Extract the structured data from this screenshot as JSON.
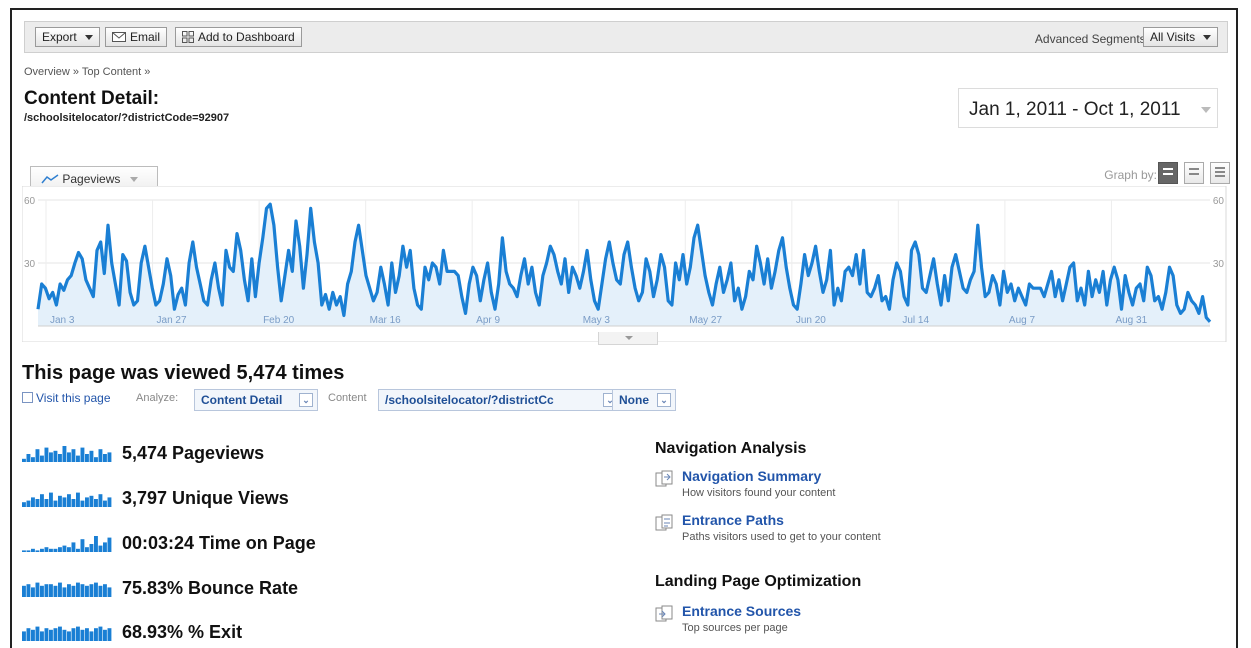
{
  "toolbar": {
    "export_label": "Export",
    "email_label": "Email",
    "dashboard_label": "Add to Dashboard",
    "segments_label": "Advanced Segments:",
    "segments_value": "All Visits"
  },
  "breadcrumb": "Overview » Top Content »",
  "page": {
    "title": "Content Detail:",
    "subtitle": "/schoolsitelocator/?districtCode=92907",
    "date_range": "Jan 1, 2011 - Oct 1, 2011"
  },
  "graph": {
    "tab_label": "Pageviews",
    "graph_by_label": "Graph by:",
    "accent": "#1a7fd4",
    "fill": "#e4f0fa"
  },
  "chart_data": {
    "type": "area",
    "ylim": [
      0,
      60
    ],
    "yticks": [
      "60",
      "30"
    ],
    "x_tick_labels": [
      "Jan 3",
      "Jan 27",
      "Feb 20",
      "Mar 16",
      "Apr 9",
      "May 3",
      "May 27",
      "Jun 20",
      "Jul 14",
      "Aug 7",
      "Aug 31"
    ],
    "series": [
      {
        "values": [
          8,
          20,
          18,
          13,
          16,
          10,
          20,
          17,
          22,
          24,
          30,
          35,
          32,
          22,
          18,
          14,
          36,
          40,
          25,
          48,
          30,
          20,
          10,
          34,
          31,
          16,
          10,
          12,
          30,
          38,
          28,
          18,
          10,
          12,
          20,
          32,
          24,
          8,
          15,
          18,
          10,
          30,
          40,
          28,
          20,
          12,
          10,
          22,
          30,
          18,
          10,
          36,
          28,
          26,
          44,
          36,
          22,
          12,
          32,
          14,
          30,
          42,
          56,
          58,
          48,
          28,
          12,
          24,
          36,
          26,
          50,
          38,
          18,
          34,
          56,
          40,
          30,
          10,
          15,
          8,
          16,
          10,
          14,
          5,
          20,
          26,
          40,
          48,
          36,
          24,
          18,
          12,
          16,
          28,
          20,
          10,
          30,
          16,
          24,
          38,
          28,
          36,
          18,
          10,
          8,
          28,
          22,
          30,
          28,
          20,
          36,
          26,
          26,
          26,
          24,
          14,
          6,
          20,
          28,
          24,
          12,
          22,
          30,
          16,
          8,
          20,
          42,
          26,
          20,
          18,
          14,
          24,
          32,
          20,
          28,
          16,
          10,
          24,
          30,
          38,
          34,
          26,
          20,
          32,
          16,
          28,
          24,
          18,
          26,
          36,
          22,
          12,
          8,
          20,
          32,
          40,
          30,
          22,
          20,
          34,
          40,
          28,
          18,
          12,
          16,
          32,
          26,
          14,
          22,
          34,
          28,
          12,
          10,
          30,
          22,
          34,
          20,
          28,
          42,
          48,
          36,
          24,
          16,
          10,
          20,
          28,
          16,
          22,
          30,
          12,
          18,
          8,
          14,
          26,
          22,
          38,
          30,
          20,
          32,
          18,
          26,
          36,
          42,
          28,
          18,
          10,
          8,
          20,
          34,
          24,
          30,
          38,
          26,
          16,
          22,
          36,
          10,
          18,
          12,
          26,
          28,
          24,
          34,
          20,
          36,
          16,
          14,
          18,
          24,
          12,
          14,
          8,
          22,
          30,
          26,
          14,
          10,
          36,
          40,
          34,
          18,
          16,
          24,
          32,
          20,
          10,
          24,
          12,
          28,
          34,
          26,
          18,
          16,
          22,
          26,
          48,
          28,
          14,
          16,
          24,
          20,
          10,
          26,
          16,
          20,
          12,
          18,
          14,
          10,
          20,
          18,
          18,
          18,
          14,
          20,
          26,
          14,
          22,
          12,
          20,
          28,
          30,
          12,
          18,
          10,
          26,
          14,
          22,
          16,
          26,
          10,
          22,
          28,
          22,
          8,
          24,
          16,
          10,
          18,
          20,
          12,
          28,
          24,
          12,
          14,
          8,
          16,
          28,
          24,
          10,
          6,
          8,
          16,
          12,
          10,
          6,
          14,
          4,
          2
        ]
      }
    ]
  },
  "summary": {
    "viewed_text": "This page was viewed 5,474 times",
    "visit_label": "Visit this page",
    "analyze_label": "Analyze:",
    "analyze_value": "Content Detail",
    "content_label": "Content",
    "content_value": "/schoolsitelocator/?districtCc",
    "none_value": "None"
  },
  "metrics": [
    {
      "text": "5,474 Pageviews"
    },
    {
      "text": "3,797 Unique Views"
    },
    {
      "text": "00:03:24 Time on Page"
    },
    {
      "text": "75.83% Bounce Rate"
    },
    {
      "text": "68.93% % Exit"
    }
  ],
  "navigation": {
    "heading": "Navigation Analysis",
    "links": [
      {
        "title": "Navigation Summary",
        "desc": "How visitors found your content"
      },
      {
        "title": "Entrance Paths",
        "desc": "Paths visitors used to get to your content"
      }
    ]
  },
  "landing": {
    "heading": "Landing Page Optimization",
    "links": [
      {
        "title": "Entrance Sources",
        "desc": "Top sources per page"
      }
    ]
  }
}
